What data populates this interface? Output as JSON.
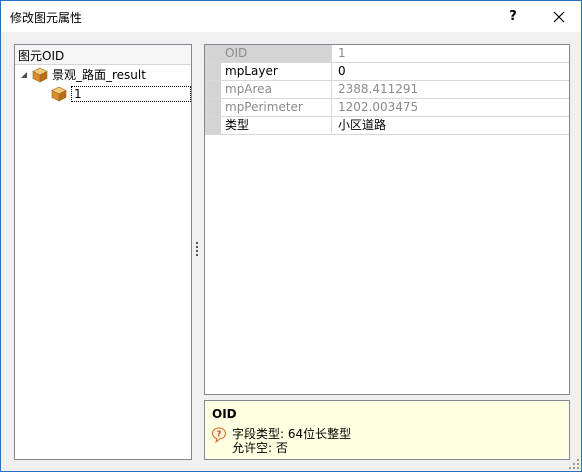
{
  "window": {
    "title": "修改图元属性",
    "help_label": "?",
    "close_icon": "close-icon"
  },
  "tree": {
    "header": "图元OID",
    "root": {
      "label": "景观_路面_result",
      "expanded": true,
      "icon": "cube-icon"
    },
    "child": {
      "label": "1",
      "selected": true,
      "icon": "cube-icon"
    }
  },
  "properties": [
    {
      "name": "OID",
      "value": "1",
      "readonly": true,
      "selected": true
    },
    {
      "name": "mpLayer",
      "value": "0",
      "readonly": false,
      "selected": false
    },
    {
      "name": "mpArea",
      "value": "2388.411291",
      "readonly": true,
      "selected": false
    },
    {
      "name": "mpPerimeter",
      "value": "1202.003475",
      "readonly": true,
      "selected": false
    },
    {
      "name": "类型",
      "value": "小区道路",
      "readonly": false,
      "selected": false
    }
  ],
  "description": {
    "title": "OID",
    "line1": "字段类型: 64位长整型",
    "line2": "允许空: 否",
    "icon": "help-balloon-icon"
  },
  "colors": {
    "border_accent": "#2b71c2",
    "description_bg": "#ffffe1",
    "readonly_text": "#8a8a8a"
  }
}
